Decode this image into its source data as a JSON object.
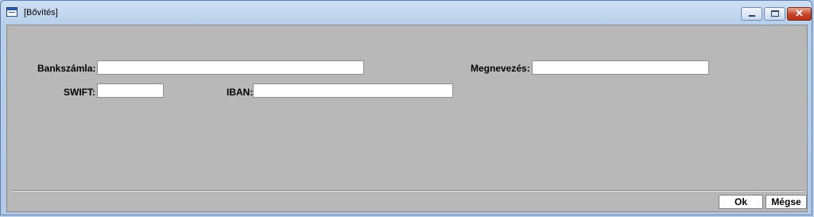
{
  "window": {
    "title": "[Bővítés]",
    "icon": "form-window-icon"
  },
  "form": {
    "bankszamla_label": "Bankszámla:",
    "bankszamla_value": "",
    "megnevezes_label": "Megnevezés:",
    "megnevezes_value": "",
    "swift_label": "SWIFT:",
    "swift_value": "",
    "iban_label": "IBAN:",
    "iban_value": ""
  },
  "buttons": {
    "ok": "Ok",
    "cancel": "Mégse"
  }
}
